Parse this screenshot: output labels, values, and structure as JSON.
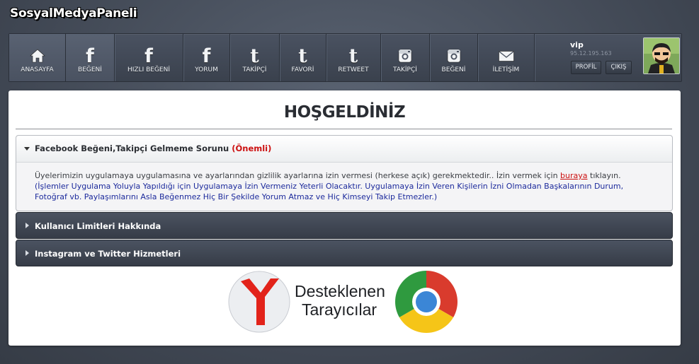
{
  "brand": "SosyalMedyaPaneli",
  "nav": [
    {
      "label": "ANASAYFA",
      "icon": "home-icon",
      "active": true
    },
    {
      "label": "BEĞENİ",
      "icon": "facebook-icon",
      "active": true
    },
    {
      "label": "HIZLI BEĞENİ",
      "icon": "facebook-icon",
      "active": false
    },
    {
      "label": "YORUM",
      "icon": "facebook-icon",
      "active": false
    },
    {
      "label": "TAKİPÇİ",
      "icon": "twitter-icon",
      "active": false
    },
    {
      "label": "FAVORİ",
      "icon": "twitter-icon",
      "active": false
    },
    {
      "label": "RETWEET",
      "icon": "twitter-icon",
      "active": false
    },
    {
      "label": "TAKİPÇİ",
      "icon": "instagram-icon",
      "active": false
    },
    {
      "label": "BEĞENİ",
      "icon": "instagram-icon",
      "active": false
    },
    {
      "label": "İLETİŞİM",
      "icon": "mail-icon",
      "active": false
    }
  ],
  "user": {
    "name": "vip",
    "ip": "95.12.195.163",
    "profile_label": "PROFİL",
    "logout_label": "ÇIKIŞ"
  },
  "main": {
    "title": "HOŞGELDİNİZ",
    "accordions": [
      {
        "title": "Facebook Beğeni,Takipçi Gelmeme Sorunu",
        "badge": "(Önemli)",
        "open": true,
        "body_part1": "Üyelerimizin uygulamaya uygulamasına ve ayarlarından gizlilik ayarlarına izin vermesi (herkese açık) gerekmektedir.. İzin vermek için ",
        "body_link": "buraya",
        "body_part2": " tıklayın.",
        "body_note": "(İşlemler Uygulama Yoluyla Yapıldığı için Uygulamaya İzin Vermeniz Yeterli Olacaktır. Uygulamaya İzin Veren Kişilerin İzni Olmadan Başkalarının Durum, Fotoğraf vb. Paylaşımlarını Asla Beğenmez Hiç Bir Şekilde Yorum Atmaz ve Hiç Kimseyi Takip Etmezler.)"
      },
      {
        "title": "Kullanıcı Limitleri Hakkında",
        "open": false
      },
      {
        "title": "Instagram ve Twitter Hizmetleri",
        "open": false
      }
    ],
    "browsers": {
      "line1": "Desteklenen",
      "line2": "Tarayıcılar"
    }
  },
  "colors": {
    "important": "#cc1010",
    "link": "#cc1010",
    "note": "#1c2a9c",
    "body_text": "#333333"
  }
}
